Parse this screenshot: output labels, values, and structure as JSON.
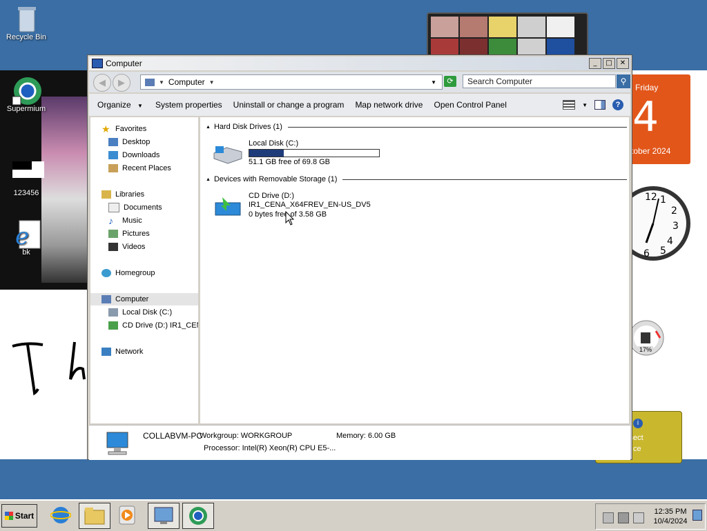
{
  "desktop": {
    "icons": [
      {
        "label": "Recycle Bin"
      },
      {
        "label": "Supermium"
      },
      {
        "label": "123456"
      },
      {
        "label": "bk"
      }
    ]
  },
  "gadgets": {
    "calendar": {
      "day_name": "Friday",
      "day": "4",
      "month_year": "tober 2024"
    },
    "cpu_meter": {
      "percent": "17%"
    },
    "network": {
      "line1": ": connect",
      "line2": "ce"
    }
  },
  "window": {
    "title": "Computer",
    "controls": {
      "minimize": "_",
      "maximize": "□",
      "close": "✕"
    },
    "address": {
      "location": "Computer"
    },
    "search": {
      "placeholder": "Search Computer"
    },
    "toolbar": {
      "organize": "Organize",
      "system_properties": "System properties",
      "uninstall": "Uninstall or change a program",
      "map_drive": "Map network drive",
      "control_panel": "Open Control Panel"
    },
    "nav": {
      "favorites": "Favorites",
      "desktop": "Desktop",
      "downloads": "Downloads",
      "recent": "Recent Places",
      "libraries": "Libraries",
      "documents": "Documents",
      "music": "Music",
      "pictures": "Pictures",
      "videos": "Videos",
      "homegroup": "Homegroup",
      "computer": "Computer",
      "local_disk": "Local Disk (C:)",
      "cd_drive": "CD Drive (D:) IR1_CEN",
      "network": "Network"
    },
    "groups": {
      "hdd_header": "Hard Disk Drives (1)",
      "removable_header": "Devices with Removable Storage (1)"
    },
    "drives": {
      "c": {
        "name": "Local Disk (C:)",
        "free_text": "51.1 GB free of 69.8 GB",
        "used_fraction": 0.268
      },
      "d": {
        "name": "CD Drive (D:)",
        "label": "IR1_CENA_X64FREV_EN-US_DV5",
        "free_text": "0 bytes free of 3.58 GB"
      }
    },
    "details": {
      "computer_name": "COLLABVM-PC",
      "workgroup": "Workgroup: WORKGROUP",
      "memory": "Memory: 6.00 GB",
      "processor": "Processor: Intel(R) Xeon(R) CPU E5-..."
    }
  },
  "taskbar": {
    "start_label": "Start",
    "time": "12:35 PM",
    "date": "10/4/2024"
  },
  "colors": {
    "accent": "#3a6ea5",
    "drive_bar": "#1f3c7a",
    "calendar": "#e2561a"
  }
}
